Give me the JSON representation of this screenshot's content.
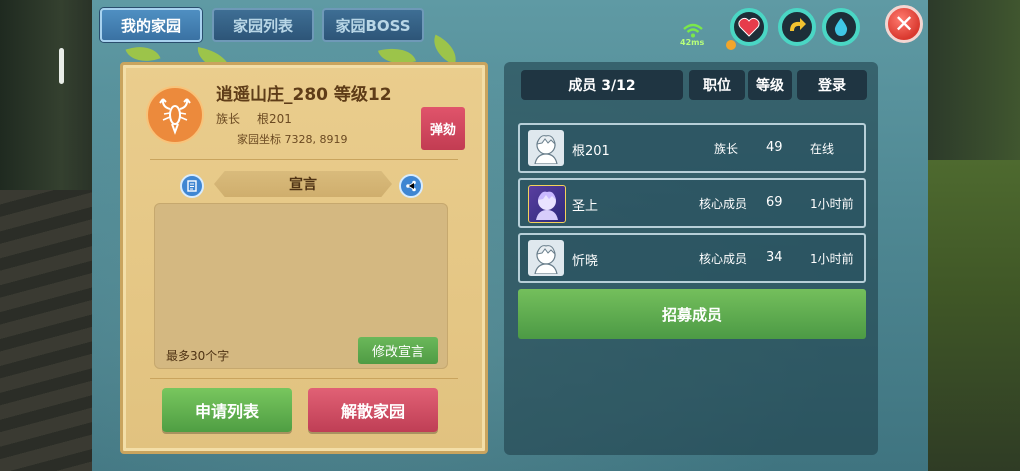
{
  "tabs": [
    {
      "label": "我的家园",
      "active": true
    },
    {
      "label": "家园列表",
      "active": false
    },
    {
      "label": "家园BOSS",
      "active": false
    }
  ],
  "status": {
    "ping": "42ms",
    "colors": {
      "heart": "#e63c4b",
      "energy": "#f2c230",
      "water": "#3fc7e6",
      "ring": "#4ad6c4"
    }
  },
  "home": {
    "emblem_icon": "lobster-icon",
    "title": "逍遥山庄_280 等级12",
    "role_label": "族长",
    "leader_name": "根201",
    "coords": "家园坐标 7328, 8919",
    "impeach_label": "弹劾"
  },
  "declaration": {
    "heading": "宣言",
    "hint": "最多30个字",
    "edit_label": "修改宣言"
  },
  "actions": {
    "apply_list": "申请列表",
    "dissolve": "解散家园"
  },
  "members": {
    "header": {
      "count": "成员 3/12",
      "role": "职位",
      "level": "等级",
      "login": "登录"
    },
    "rows": [
      {
        "name": "根201",
        "role": "族长",
        "level": "49",
        "login": "在线",
        "avatar": "white-hair-avatar"
      },
      {
        "name": "圣上",
        "role": "核心成员",
        "level": "69",
        "login": "1小时前",
        "avatar": "purple-frame-avatar"
      },
      {
        "name": "忻晓",
        "role": "核心成员",
        "level": "34",
        "login": "1小时前",
        "avatar": "white-hair-avatar"
      }
    ],
    "recruit_label": "招募成员"
  }
}
